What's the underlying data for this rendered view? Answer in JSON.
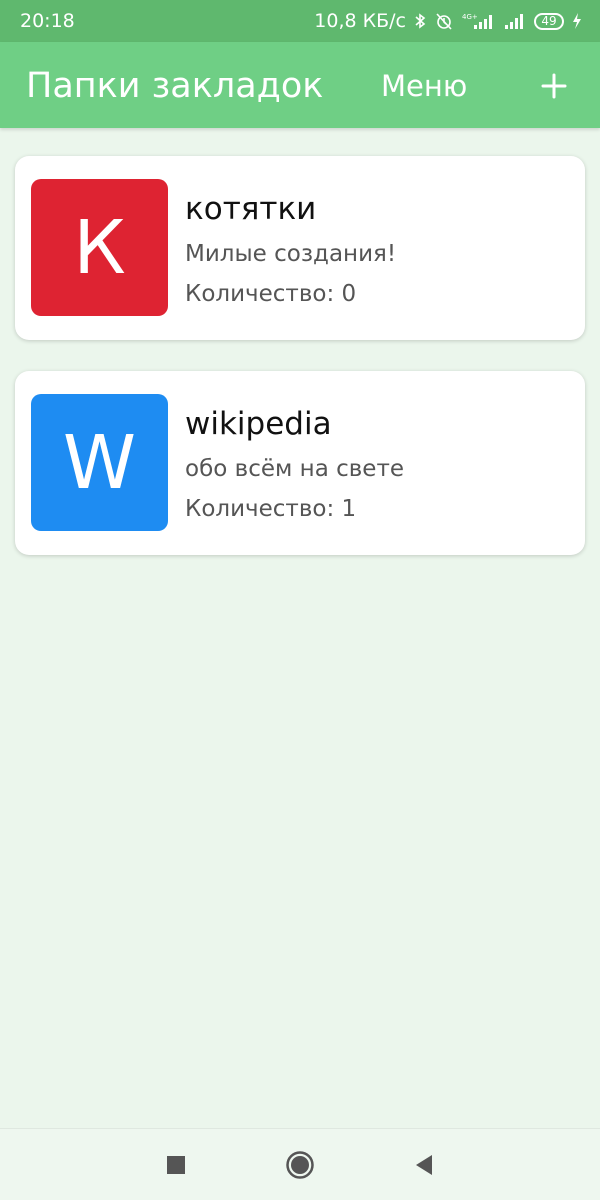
{
  "status_bar": {
    "time": "20:18",
    "network_speed": "10,8 КБ/с",
    "network_type": "4G+",
    "battery_level": "49",
    "icons": [
      "bluetooth-icon",
      "alarm-off-icon",
      "signal-4g-icon",
      "signal-icon",
      "battery-icon",
      "charging-icon"
    ]
  },
  "app_bar": {
    "title": "Папки закладок",
    "menu_label": "Меню",
    "add_label": "+"
  },
  "folders": [
    {
      "letter": "К",
      "title": "котятки",
      "description": "Милые создания!",
      "count": "Количество: 0",
      "color": "#de2332"
    },
    {
      "letter": "W",
      "title": "wikipedia",
      "description": "обо всём на свете",
      "count": "Количество: 1",
      "color": "#1e8cf2"
    }
  ],
  "nav_bar": {
    "icons": [
      "recent-apps-icon",
      "home-icon",
      "back-icon"
    ]
  },
  "colors": {
    "status_bar": "#5fb86e",
    "app_bar": "#6fcf85",
    "background": "#ebf6ec"
  }
}
